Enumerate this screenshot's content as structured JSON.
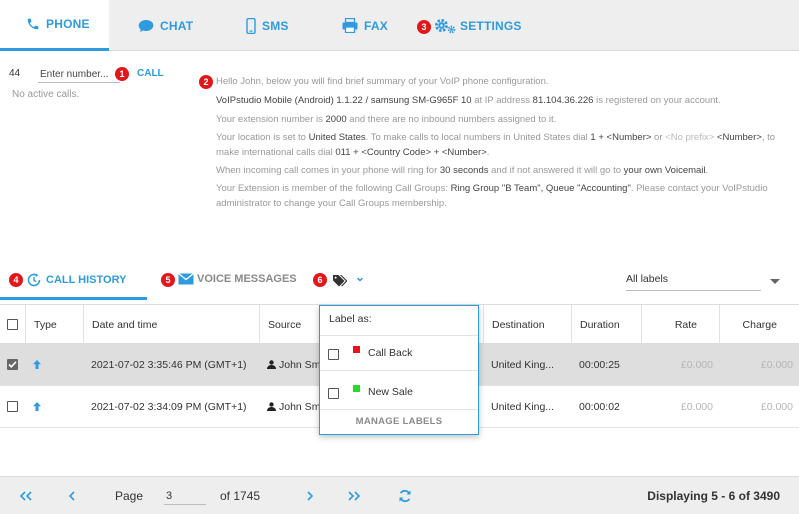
{
  "top_tabs": [
    {
      "label": "PHONE",
      "icon": "phone-icon",
      "active": true
    },
    {
      "label": "CHAT",
      "icon": "chat-icon",
      "active": false
    },
    {
      "label": "SMS",
      "icon": "sms-icon",
      "active": false
    },
    {
      "label": "FAX",
      "icon": "fax-icon",
      "active": false
    },
    {
      "label": "SETTINGS",
      "icon": "gear-icon",
      "active": false
    }
  ],
  "badges": [
    "1",
    "2",
    "3",
    "4",
    "5",
    "6"
  ],
  "dialer": {
    "prefix": "44",
    "number_placeholder": "Enter number...",
    "number_value": "",
    "call_label": "CALL",
    "no_active_calls": "No active calls."
  },
  "info": {
    "greeting": "Hello John, below you will find brief summary of your VoIP phone configuration.",
    "device": "VoIPstudio Mobile (Android) 1.1.22 / samsung SM-G965F 10",
    "ip_pre": " at IP address ",
    "ip": "81.104.36.226",
    "ip_post": " is registered on your account.",
    "ext_pre": "Your extension number is ",
    "ext": "2000",
    "ext_post": " and there are no inbound numbers assigned to it.",
    "loc_pre": "Your location is set to ",
    "loc": "United States",
    "loc_mid": ". To make calls to local numbers in United States dial ",
    "loc_dial": "1 + <Number>",
    "loc_or": " or ",
    "loc_noprefix": "<No prefix>",
    "loc_num": " <Number>",
    "loc_intl": ", to make international calls dial ",
    "loc_intl_code": "011 + <Country Code> + <Number>",
    "loc_end": ".",
    "ring_pre": "When incoming call comes in your phone will ring for ",
    "ring": "30 seconds",
    "ring_mid": " and if not answered it will go to ",
    "ring_vm": "your own Voicemail",
    "ring_end": ".",
    "groups_pre": "Your Extension is member of the following Call Groups: ",
    "groups": "Ring Group \"B Team\", Queue \"Accounting\"",
    "groups_post": ". Please contact your VoIPstudio administrator to change your Call Groups membership."
  },
  "sub_tabs": {
    "call_history": "CALL HISTORY",
    "voice_messages": "VOICE MESSAGES",
    "labels_caret": "⌄"
  },
  "label_filter": "All labels",
  "table": {
    "headers": [
      "Type",
      "Date and time",
      "Source",
      "Destination",
      "Duration",
      "Rate",
      "Charge"
    ],
    "rows": [
      {
        "selected": true,
        "datetime": "2021-07-02 3:35:46 PM (GMT+1)",
        "source": "John Sm",
        "destination": "United King...",
        "duration": "00:00:25",
        "rate": "£0.000",
        "charge": "£0.000"
      },
      {
        "selected": false,
        "datetime": "2021-07-02 3:34:09 PM (GMT+1)",
        "source": "John Sm",
        "destination": "United King...",
        "duration": "00:00:02",
        "rate": "£0.000",
        "charge": "£0.000"
      }
    ]
  },
  "label_popup": {
    "title": "Label as:",
    "items": [
      {
        "label": "Call Back",
        "color": "#e8141b"
      },
      {
        "label": "New Sale",
        "color": "#22dd22"
      }
    ],
    "manage": "MANAGE LABELS"
  },
  "pagination": {
    "page_label": "Page",
    "page_value": "3",
    "of_label": "of 1745",
    "display": "Displaying 5 - 6 of 3490"
  },
  "colors": {
    "accent": "#2e9be0",
    "badge": "#e3161b"
  }
}
